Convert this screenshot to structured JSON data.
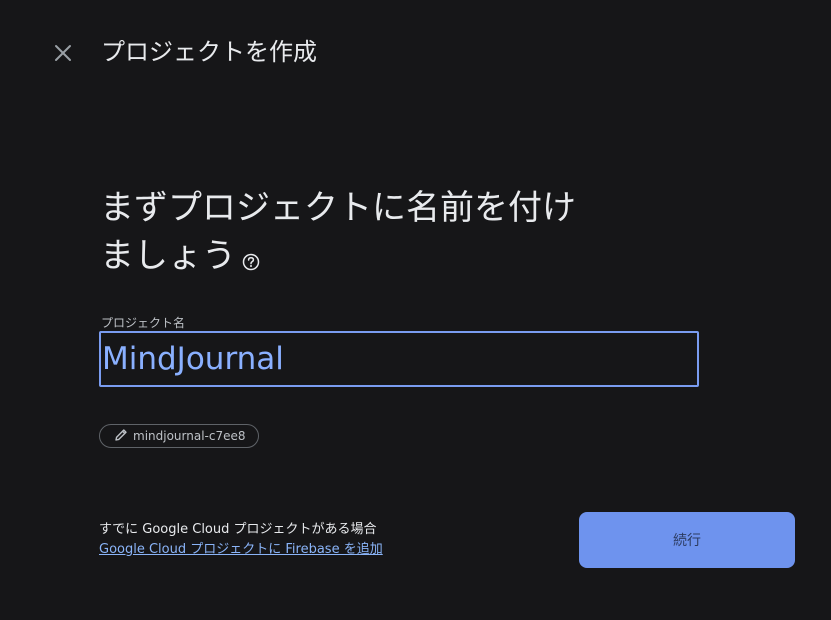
{
  "header": {
    "title": "プロジェクトを作成"
  },
  "main": {
    "heading": "まずプロジェクトに名前を付けましょう",
    "field_label": "プロジェクト名",
    "project_name_value": "MindJournal",
    "project_id": "mindjournal-c7ee8"
  },
  "footer": {
    "gcp_text": "すでに Google Cloud プロジェクトがある場合",
    "gcp_link": "Google Cloud プロジェクトに Firebase を追加",
    "continue_label": "続行"
  },
  "icons": {
    "close": "close-icon",
    "help": "help-circle-icon",
    "edit": "pencil-icon"
  },
  "colors": {
    "background": "#161618",
    "accent": "#7a9cf0",
    "link": "#8ab4f8",
    "button": "#6e93ee"
  }
}
